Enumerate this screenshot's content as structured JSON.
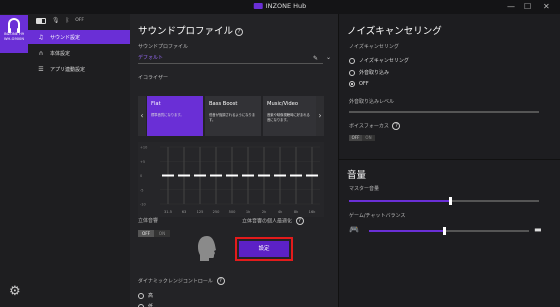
{
  "window": {
    "title": "INZONE Hub",
    "minimize": "—",
    "maximize": "☐",
    "close": "✕"
  },
  "sidebar": {
    "device_name": "INZONE H9\nWH-G900N",
    "status_off": "OFF",
    "items": [
      {
        "label": "サウンド設定",
        "icon": "headphone"
      },
      {
        "label": "本体設定",
        "icon": "headphone"
      },
      {
        "label": "アプリ連動設定",
        "icon": "list"
      }
    ]
  },
  "main": {
    "title": "サウンドプロファイル",
    "help": "?",
    "profile_label": "サウンドプロファイル",
    "profile_value": "デフォルト",
    "eq_label": "イコライザー",
    "presets": [
      {
        "name": "Flat",
        "desc": "標準音質になります。"
      },
      {
        "name": "Bass Boost",
        "desc": "低音が強調されるようになります。"
      },
      {
        "name": "Music/Video",
        "desc": "音楽や映像視聴時に好まれる音になります。"
      }
    ],
    "eq_db": [
      "+10",
      "+5",
      "0",
      "-5",
      "-10"
    ],
    "eq_freqs": [
      "31.5",
      "63",
      "125",
      "250",
      "500",
      "1k",
      "2k",
      "4k",
      "8k",
      "16k"
    ],
    "eq_values": [
      0,
      0,
      0,
      0,
      0,
      0,
      0,
      0,
      0,
      0
    ],
    "spatial_label": "立体音響",
    "spatial_toggle": [
      "OFF",
      "ON"
    ],
    "personal_label": "立体音響の個人最適化",
    "settings_button": "設定",
    "dynamic_label": "ダイナミックレンジコントロール",
    "dynamic_options": [
      "高",
      "低"
    ]
  },
  "noise": {
    "title": "ノイズキャンセリング",
    "section": "ノイズキャンセリング",
    "options": [
      "ノイズキャンセリング",
      "外音取り込み",
      "OFF"
    ],
    "selected": "OFF",
    "ambient_level_label": "外音取り込みレベル",
    "ambient_level": 0,
    "voice_focus_label": "ボイスフォーカス",
    "voice_focus_toggle": [
      "OFF",
      "ON"
    ]
  },
  "volume": {
    "title": "音量",
    "master_label": "マスター音量",
    "master_level": 0.53,
    "balance_label": "ゲーム/チャットバランス",
    "balance_level": 0.47
  }
}
